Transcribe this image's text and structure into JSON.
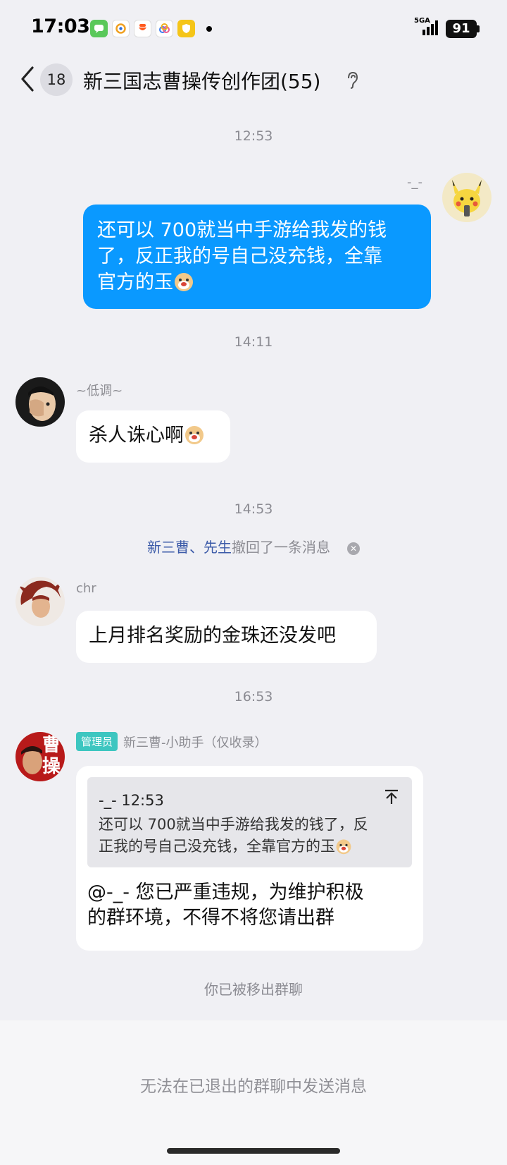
{
  "status_bar": {
    "time": "17:03",
    "network": "5GA",
    "battery": "91"
  },
  "header": {
    "unread_count": "18",
    "title": "新三国志曹操传创作团(55)"
  },
  "messages": {
    "ts1": "12:53",
    "m1_sender": "-_-",
    "m1_text_line1": "还可以 700就当中手游给我发的钱",
    "m1_text_line2": "了，反正我的号自己没充钱，全靠",
    "m1_text_line3": "官方的玉",
    "ts2": "14:11",
    "m2_sender": "~低调~",
    "m2_text": "杀人诛心啊",
    "ts3": "14:53",
    "recall_names": "新三曹、先生",
    "recall_text": "撤回了一条消息",
    "m3_sender": "chr",
    "m3_text": "上月排名奖励的金珠还没发吧",
    "ts4": "16:53",
    "m4_badge": "管理员",
    "m4_sender": "新三曹-小助手（仅收录）",
    "m4_quote_header": "-_- 12:53",
    "m4_quote_line1": "还可以 700就当中手游给我发的钱了，反",
    "m4_quote_line2": "正我的号自己没充钱，全靠官方的玉",
    "m4_text_line1": "@-_- 您已严重违规，为维护积极",
    "m4_text_line2": "的群环境，不得不将您请出群",
    "removed_notice": "你已被移出群聊"
  },
  "footer": {
    "text": "无法在已退出的群聊中发送消息"
  },
  "colors": {
    "accent_blue": "#0a99ff",
    "admin_badge": "#3dc6c0",
    "background": "#f0f0f4"
  }
}
